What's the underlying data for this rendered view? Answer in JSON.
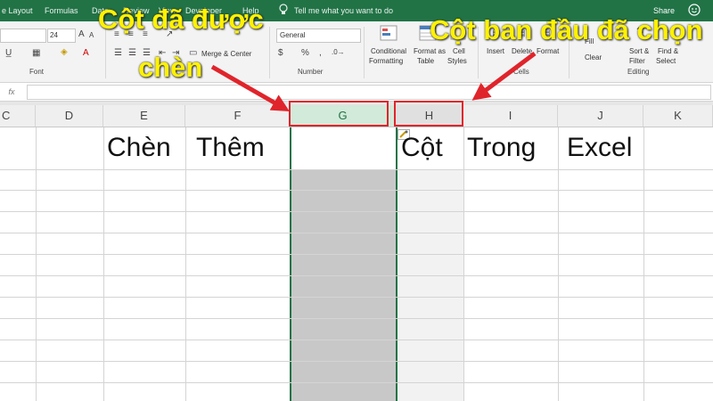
{
  "ribbon_tabs": [
    "e Layout",
    "Formulas",
    "Data",
    "Review",
    "View",
    "Developer",
    "Help"
  ],
  "tell_me": "Tell me what you want to do",
  "share": "Share",
  "font": {
    "size": "24",
    "group_label": "Font"
  },
  "alignment": {
    "merge_label": "Merge & Center"
  },
  "number": {
    "format": "General",
    "group_label": "Number",
    "percent": "%",
    "comma": ","
  },
  "styles": {
    "conditional": "Conditional",
    "formatting": "Formatting",
    "format_as": "Format as",
    "table": "Table",
    "cell": "Cell",
    "styles": "Styles"
  },
  "cells_group": {
    "insert": "Insert",
    "delete": "Delete",
    "format": "Format",
    "label": "Cells"
  },
  "editing": {
    "fill": "Fill",
    "clear": "Clear",
    "sort": "Sort &",
    "filter": "Filter",
    "find": "Find &",
    "select": "Select",
    "label": "Editing"
  },
  "formula_bar": {
    "fx": "fx"
  },
  "columns": [
    "C",
    "D",
    "E",
    "F",
    "G",
    "H",
    "I",
    "J",
    "K"
  ],
  "cell_texts": {
    "E": "Chèn",
    "F": "Thêm",
    "H": "Cột",
    "I": "Trong",
    "J": "Excel"
  },
  "annotations": {
    "left_line1": "Cột đã được",
    "left_line2": "chèn",
    "right": "Cột ban đầu đã chọn"
  },
  "colors": {
    "excel_green": "#217346",
    "arrow_red": "#e0242b",
    "annotation_yellow": "#fff200"
  }
}
